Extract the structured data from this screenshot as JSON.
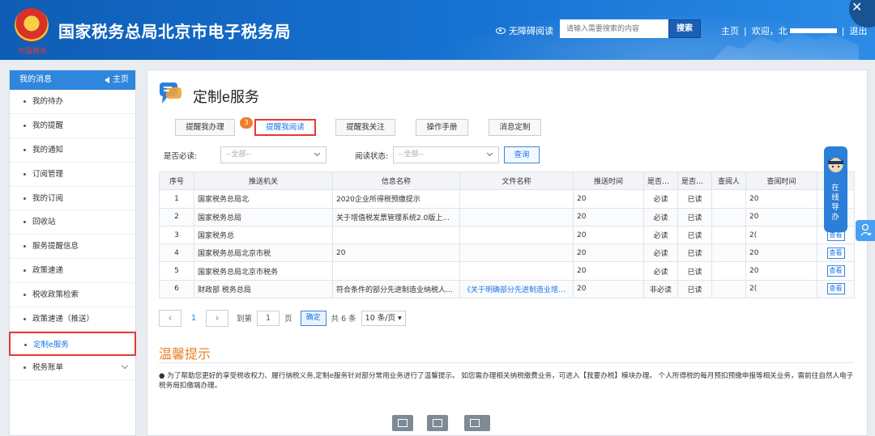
{
  "header": {
    "site_title": "国家税务总局北京市电子税务局",
    "emblem_caption": "中国税务",
    "accessible_reading": "无障碍阅读",
    "search_placeholder": "请输入需要搜索的内容",
    "search_button": "搜索",
    "nav_home": "主页",
    "nav_welcome": "欢迎，北",
    "nav_logout": "退出",
    "separator": "|"
  },
  "sidebar": {
    "header": "我的消息",
    "home_link": "主页",
    "items": [
      {
        "label": "我的待办"
      },
      {
        "label": "我的提醒"
      },
      {
        "label": "我的通知"
      },
      {
        "label": "订阅管理"
      },
      {
        "label": "我的订阅"
      },
      {
        "label": "回收站"
      },
      {
        "label": "服务提醒信息"
      },
      {
        "label": "政策速递"
      },
      {
        "label": "税收政策检索"
      },
      {
        "label": "政策速递（推送）"
      },
      {
        "label": "定制e服务",
        "active": true
      },
      {
        "label": "税务账单",
        "expandable": true
      }
    ]
  },
  "main": {
    "title": "定制e服务",
    "tabs": [
      {
        "label": "提醒我办理"
      },
      {
        "label": "提醒我阅读",
        "active": true,
        "badge": "3"
      },
      {
        "label": "提醒我关注"
      },
      {
        "label": "操作手册"
      },
      {
        "label": "消息定制"
      }
    ],
    "filters": {
      "required_label": "是否必读:",
      "required_value": "--全部--",
      "status_label": "阅读状态:",
      "status_value": "--全部--",
      "query_button": "查询"
    },
    "table": {
      "columns": [
        "序号",
        "推送机关",
        "信息名称",
        "文件名称",
        "推送时间",
        "是否必...",
        "是否已...",
        "查阅人",
        "查阅时间",
        ""
      ],
      "rows": [
        {
          "no": "1",
          "org": "国家税务总局北",
          "info": "2020企业所得税预缴提示",
          "file": "",
          "time": "20",
          "required": "必读",
          "read": "已读",
          "reader": "",
          "read_time": "20",
          "action": ""
        },
        {
          "no": "2",
          "org": "国家税务总局",
          "info": "关于增值税发票管理系统2.0版上...",
          "file": "",
          "time": "20",
          "required": "必读",
          "read": "已读",
          "reader": "",
          "read_time": "20",
          "action": ""
        },
        {
          "no": "3",
          "org": "国家税务总",
          "info": "",
          "file": "",
          "time": "20",
          "required": "必读",
          "read": "已读",
          "reader": "",
          "read_time": "2(",
          "action": "查看"
        },
        {
          "no": "4",
          "org": "国家税务总局北京市税",
          "info": "20",
          "file": "",
          "time": "20",
          "required": "必读",
          "read": "已读",
          "reader": "",
          "read_time": "20",
          "action": "查看"
        },
        {
          "no": "5",
          "org": "国家税务总局北京市税务",
          "info": "",
          "file": "",
          "time": "20",
          "required": "必读",
          "read": "已读",
          "reader": "",
          "read_time": "20",
          "action": "查看"
        },
        {
          "no": "6",
          "org": "财政部 税务总局",
          "info": "符合条件的部分先进制造业纳税人...",
          "file": "《关于明确部分先进制造业增值...",
          "time": "20",
          "required": "非必读",
          "read": "已读",
          "reader": "",
          "read_time": "2(",
          "action": "查看"
        }
      ]
    },
    "pager": {
      "current": "1",
      "goto_label": "到第",
      "goto_value": "1",
      "page_unit": "页",
      "confirm": "确定",
      "total": "共 6 条",
      "page_size": "10 条/页"
    },
    "tips": {
      "title": "温馨提示",
      "text": "● 为了帮助您更好的享受税收权力、履行纳税义务,定制e服务针对部分常用业务进行了温馨提示。 如您需办理相关纳税缴费业务，可进入【我要办税】模块办理。 个人所得税的每月预扣预缴申报等相关业务，需前往自然人电子税务局扣缴端办理。"
    },
    "guide_text": "在线导办"
  },
  "colors": {
    "header_blue": "#1773d3",
    "sidebar_head": "#2f86dc",
    "highlight_red": "#e53935",
    "link_blue": "#1a73e8",
    "tips_orange": "#e9812a",
    "badge_orange": "#ef7e2c"
  }
}
